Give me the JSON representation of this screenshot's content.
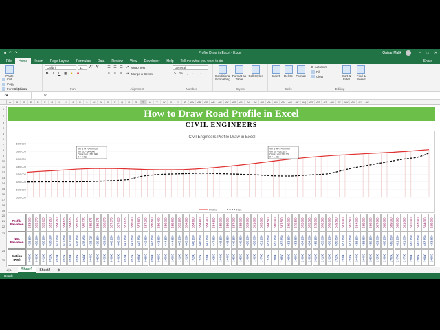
{
  "window": {
    "title": "Profile Draw in Excel  -  Excel",
    "user": "Qaisar Malik"
  },
  "tabs": [
    "File",
    "Home",
    "Insert",
    "Page Layout",
    "Formulas",
    "Data",
    "Review",
    "View",
    "Developer",
    "Help"
  ],
  "tell_me": "Tell me what you want to do",
  "share_label": "Share",
  "ribbon": {
    "clipboard": {
      "paste": "Paste",
      "cut": "Cut",
      "copy": "Copy",
      "format_painter": "Format Painter",
      "label": "Clipboard"
    },
    "font": {
      "name": "Calibri",
      "size": "11",
      "label": "Font"
    },
    "alignment": {
      "wrap": "Wrap Text",
      "merge": "Merge & Center",
      "label": "Alignment"
    },
    "number": {
      "format": "General",
      "label": "Number"
    },
    "styles": {
      "conditional": "Conditional Formatting",
      "table": "Format as Table",
      "cell": "Cell Styles",
      "label": "Styles"
    },
    "cells": {
      "insert": "Insert",
      "delete": "Delete",
      "format": "Format",
      "label": "Cells"
    },
    "editing": {
      "autosum": "AutoSum",
      "fill": "Fill",
      "clear": "Clear",
      "sort": "Sort & Filter",
      "find": "Find & Select",
      "label": "Editing"
    }
  },
  "namebox": "T24",
  "fx_label": "fx",
  "columns": [
    "A",
    "B",
    "C",
    "D",
    "E",
    "F",
    "G",
    "H",
    "I",
    "J",
    "K",
    "L",
    "M",
    "N",
    "O",
    "P",
    "Q",
    "R",
    "S",
    "T",
    "U",
    "V",
    "W",
    "X",
    "Y",
    "Z",
    "AA",
    "AB",
    "AC",
    "AD",
    "AE",
    "AF",
    "AG",
    "AH",
    "AI",
    "AJ",
    "AK",
    "AL",
    "AM",
    "AN",
    "AO",
    "AP",
    "AQ",
    "AR",
    "AS",
    "AT",
    "AU",
    "AV",
    "AW",
    "AX",
    "AY",
    "AZ"
  ],
  "rows": [
    "1",
    "2",
    "3",
    "4",
    "5",
    "6",
    "7",
    "8",
    "9",
    "10",
    "11",
    "12",
    "13",
    "14",
    "15",
    "16",
    "17",
    "18",
    "19",
    "20",
    "21",
    "22",
    "23",
    "24",
    "25"
  ],
  "banner": "How to Draw Road Profile in Excel",
  "subbanner": "CIVIL ENGINEERS",
  "sheets": [
    "Sheet1",
    "Sheet2"
  ],
  "status": "Ready",
  "table_labels": {
    "profile": "Profile Elevation",
    "nsl": "NSL Elevation",
    "station": "Station (KM)"
  },
  "chart_data": {
    "type": "line",
    "title": "Civil Engineers Profile Draw in Excel",
    "ylim": [
      620,
      690
    ],
    "y_ticks": [
      "690.000",
      "680.000",
      "670.000",
      "660.000",
      "650.000",
      "640.000",
      "630.000",
      "620.000"
    ],
    "legend": "bottom",
    "series": [
      {
        "name": "Profile",
        "color": "#e03030",
        "style": "solid",
        "values": [
          652.8,
          653.3,
          653.8,
          654.2,
          654.6,
          655.1,
          655.6,
          656.1,
          656.6,
          657.0,
          657.3,
          657.5,
          657.6,
          657.6,
          657.5,
          657.4,
          657.2,
          657.0,
          656.7,
          656.4,
          656.2,
          656.0,
          655.9,
          655.9,
          655.9,
          656.0,
          656.2,
          656.5,
          656.9,
          657.4,
          658.0,
          658.6,
          659.3,
          660.0,
          660.8,
          661.6,
          662.5,
          663.4,
          664.3,
          665.3,
          666.2,
          667.2,
          668.1,
          669.0,
          669.8,
          670.6,
          671.4,
          672.1,
          672.8,
          673.4,
          674.0,
          674.6,
          675.1,
          675.5,
          676.0,
          676.4,
          676.8,
          677.2,
          677.6,
          678.0,
          678.4,
          678.8,
          679.3,
          679.8,
          680.4,
          681.0,
          681.6,
          682.2
        ]
      },
      {
        "name": "NSL",
        "color": "#111111",
        "style": "dashed",
        "values": [
          640.0,
          640.1,
          640.2,
          640.2,
          640.3,
          640.3,
          640.2,
          640.2,
          640.2,
          640.3,
          640.4,
          640.6,
          640.9,
          641.2,
          641.5,
          641.9,
          642.4,
          643.1,
          645.5,
          647.5,
          648.5,
          649.3,
          649.9,
          650.2,
          650.5,
          650.7,
          650.9,
          651.1,
          651.4,
          651.5,
          651.5,
          651.2,
          651.0,
          650.8,
          650.5,
          650.3,
          650.0,
          649.8,
          649.5,
          649.0,
          648.5,
          648.1,
          647.9,
          647.8,
          647.8,
          648.2,
          648.7,
          649.2,
          649.6,
          650.0,
          650.6,
          652.0,
          654.0,
          656.0,
          657.7,
          659.2,
          660.6,
          662.0,
          663.4,
          664.8,
          666.2,
          667.5,
          668.8,
          670.0,
          671.0,
          672.0,
          674.5,
          678.0
        ]
      }
    ],
    "annotations": [
      {
        "lines": [
          "VPI STA  =0+800.000",
          "VPI EL    = 684.300",
          "Curve Len =150.000",
          "K          = 0.713"
        ],
        "at_index": 10
      },
      {
        "lines": [
          "VPI STA  =2+000.000",
          "VPI EL    = 651.287",
          "Curve Len =150.000",
          "K          = 1.466"
        ],
        "at_index": 42
      }
    ],
    "profile_labels": [
      "653.000",
      "653.375",
      "653.625",
      "653.950",
      "654.250",
      "654.625",
      "654.875",
      "655.125",
      "655.375",
      "655.875",
      "656.375",
      "656.875",
      "657.375",
      "657.625",
      "657.875",
      "658.000",
      "657.600",
      "657.200",
      "656.800",
      "656.400",
      "656.000",
      "655.600",
      "655.200",
      "654.800",
      "654.600",
      "654.400",
      "654.200",
      "654.500",
      "655.000",
      "656.000",
      "657.000",
      "658.000",
      "659.000",
      "661.000",
      "663.000",
      "664.500",
      "666.000",
      "667.500",
      "669.000",
      "670.500",
      "672.000",
      "673.500",
      "675.000",
      "676.500",
      "678.000",
      "679.500",
      "681.000",
      "682.500",
      "684.000",
      "685.000",
      "686.000",
      "687.000",
      "688.000",
      "689.000",
      "690.000",
      "691.000",
      "692.000",
      "693.000",
      "694.000",
      "695.000"
    ],
    "nsl_labels": [
      "638.150",
      "638.200",
      "638.100",
      "638.000",
      "637.950",
      "637.850",
      "637.900",
      "638.150",
      "638.450",
      "638.725",
      "639.150",
      "639.650",
      "640.150",
      "640.650",
      "641.150",
      "641.650",
      "642.150",
      "642.650",
      "643.150",
      "643.650",
      "644.150",
      "644.650",
      "645.150",
      "645.650",
      "646.150",
      "646.650",
      "647.150",
      "647.650",
      "648.150",
      "648.650",
      "649.150",
      "649.650",
      "650.150",
      "650.650",
      "651.150",
      "651.650",
      "652.150",
      "652.650",
      "653.150",
      "653.650",
      "654.150",
      "654.650",
      "655.150",
      "655.650",
      "656.150",
      "656.650",
      "657.150",
      "657.650",
      "658.150",
      "658.650",
      "659.150",
      "659.650",
      "660.150",
      "660.650",
      "661.150",
      "661.650",
      "662.150",
      "662.650",
      "663.150",
      "663.650"
    ],
    "station_labels": [
      "0+000",
      "0+050",
      "0+100",
      "0+150",
      "0+200",
      "0+250",
      "0+300",
      "0+350",
      "0+400",
      "0+450",
      "0+500",
      "0+550",
      "0+600",
      "0+650",
      "0+700",
      "0+750",
      "0+800",
      "0+850",
      "0+900",
      "0+950",
      "1+000",
      "1+050",
      "1+100",
      "1+150",
      "1+200",
      "1+250",
      "1+300",
      "1+350",
      "1+400",
      "1+450",
      "1+500",
      "1+550",
      "1+600",
      "1+650",
      "1+700",
      "1+750",
      "1+800",
      "1+850",
      "1+900",
      "1+950",
      "2+000",
      "2+050",
      "2+100",
      "2+150",
      "2+200",
      "2+250",
      "2+300",
      "2+350",
      "2+400",
      "2+450",
      "2+500",
      "2+550",
      "2+600",
      "2+650",
      "2+700",
      "2+750",
      "2+800",
      "2+850",
      "2+900",
      "2+950"
    ]
  }
}
